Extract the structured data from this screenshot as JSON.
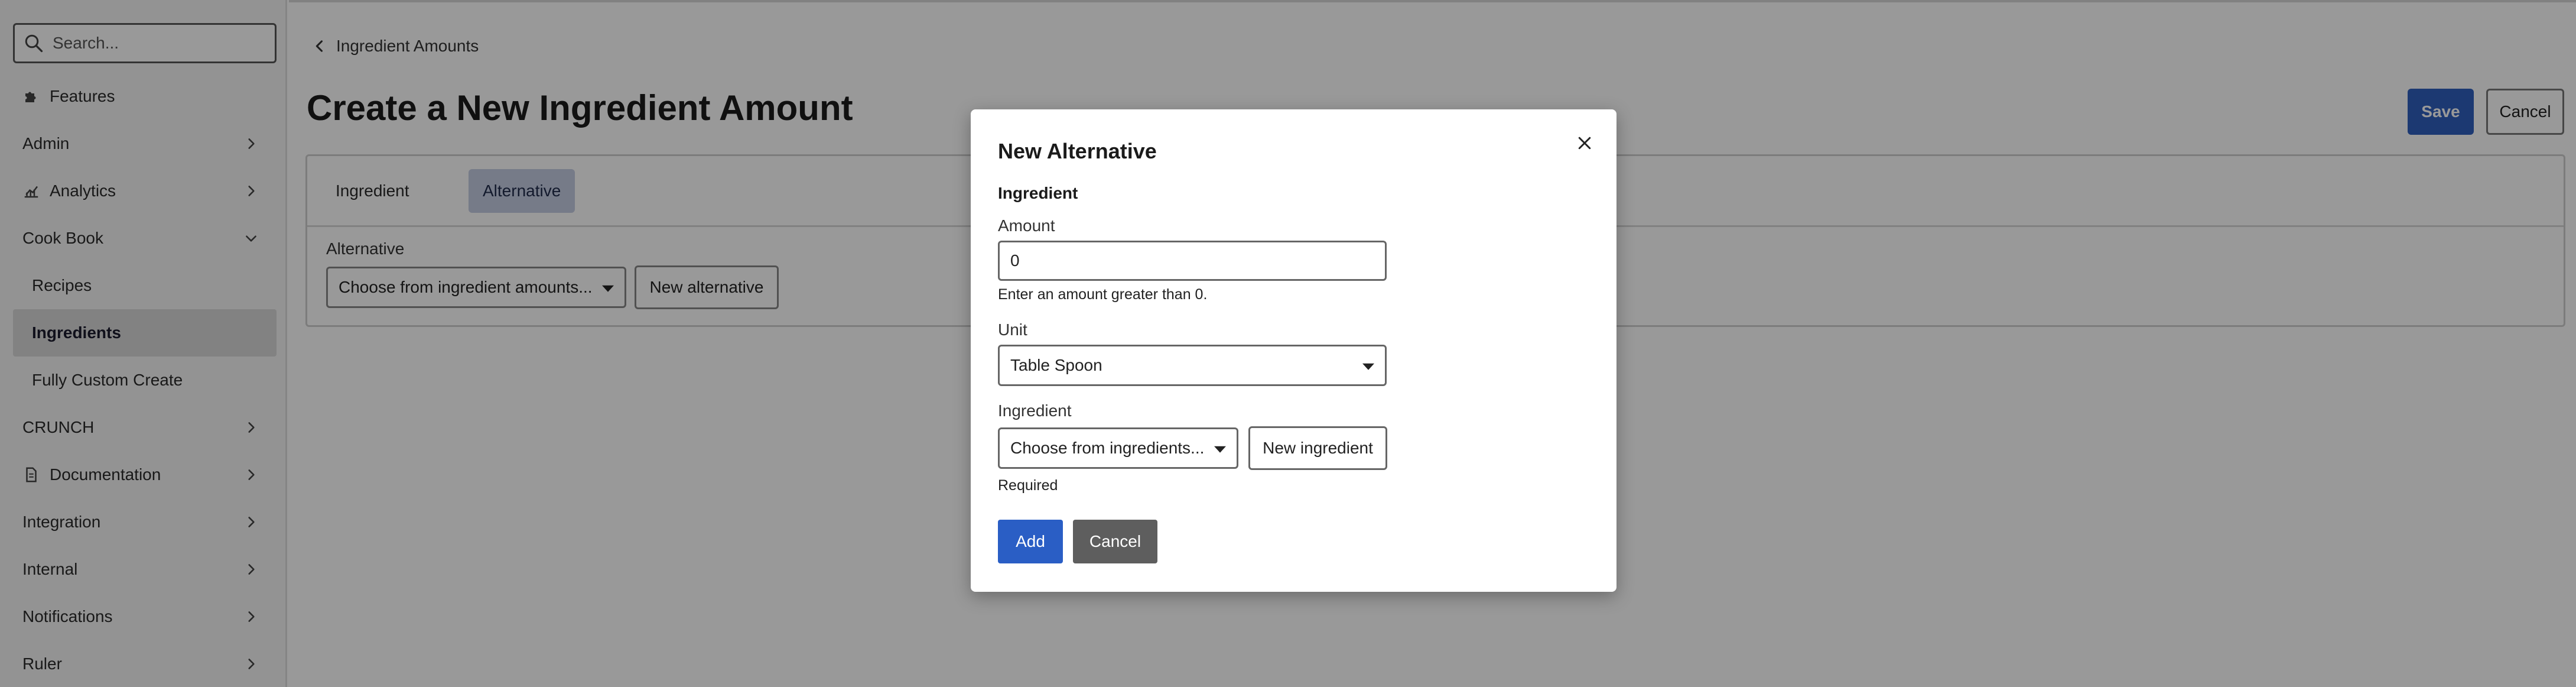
{
  "sidebar": {
    "search_placeholder": "Search...",
    "items": [
      {
        "label": "Features",
        "icon": "puzzle-icon"
      },
      {
        "label": "Admin",
        "icon": ""
      },
      {
        "label": "Analytics",
        "icon": "chart-icon"
      },
      {
        "label": "Cook Book",
        "icon": ""
      },
      {
        "label": "Recipes"
      },
      {
        "label": "Ingredients"
      },
      {
        "label": "Fully Custom Create"
      },
      {
        "label": "CRUNCH"
      },
      {
        "label": "Documentation",
        "icon": "document-icon"
      },
      {
        "label": "Integration"
      },
      {
        "label": "Internal"
      },
      {
        "label": "Notifications"
      },
      {
        "label": "Ruler"
      }
    ]
  },
  "header": {
    "breadcrumb": "Ingredient Amounts",
    "title": "Create a New Ingredient Amount",
    "save_label": "Save",
    "cancel_label": "Cancel"
  },
  "form": {
    "tabs": [
      {
        "label": "Ingredient"
      },
      {
        "label": "Alternative"
      }
    ],
    "alternative_label": "Alternative",
    "alternative_select": "Choose from ingredient amounts...",
    "new_alternative_label": "New alternative"
  },
  "modal": {
    "title": "New Alternative",
    "section": "Ingredient",
    "amount_label": "Amount",
    "amount_value": "0",
    "amount_help": "Enter an amount greater than 0.",
    "unit_label": "Unit",
    "unit_value": "Table Spoon",
    "ingredient_label": "Ingredient",
    "ingredient_select": "Choose from ingredients...",
    "new_ingredient_label": "New ingredient",
    "ingredient_required": "Required",
    "add_label": "Add",
    "cancel_label": "Cancel"
  },
  "colors": {
    "primary": "#2a5ec5",
    "active_tab": "#c5cde3",
    "sidebar_active": "#d9d9d9"
  }
}
